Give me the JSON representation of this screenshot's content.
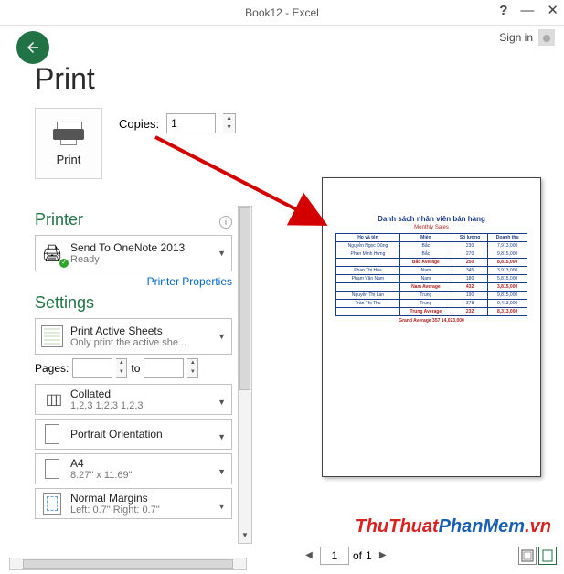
{
  "title": "Book12 - Excel",
  "signin": "Sign in",
  "back_aria": "Back",
  "page_header": "Print",
  "print_button": "Print",
  "copies": {
    "label": "Copies:",
    "value": "1"
  },
  "printer": {
    "header": "Printer",
    "name": "Send To OneNote 2013",
    "status": "Ready",
    "properties_link": "Printer Properties"
  },
  "settings": {
    "header": "Settings",
    "active_sheets": {
      "l1": "Print Active Sheets",
      "l2": "Only print the active she..."
    },
    "pages": {
      "label": "Pages:",
      "from": "",
      "to_label": "to",
      "to": ""
    },
    "collated": {
      "l1": "Collated",
      "l2": "1,2,3   1,2,3   1,2,3"
    },
    "orientation": "Portrait Orientation",
    "paper": {
      "l1": "A4",
      "l2": "8.27\" x 11.69\""
    },
    "margins": {
      "l1": "Normal Margins",
      "l2": "Left: 0.7\"   Right: 0.7\""
    }
  },
  "preview_doc": {
    "title": "Danh sách nhân viên bán hàng",
    "subtitle": "Monthly Sales",
    "headers": [
      "Họ và tên",
      "Miền",
      "Số lượng",
      "Doanh thu"
    ],
    "rows": [
      [
        "Nguyễn Ngọc Dũng",
        "Bắc",
        "230",
        "7,913,000"
      ],
      [
        "Phan Minh Hưng",
        "Bắc",
        "270",
        "9,815,000"
      ],
      [
        "",
        "Bắc Average",
        "250",
        "8,815,000"
      ],
      [
        "Phan Thị Hòa",
        "Nam",
        "345",
        "3,913,000"
      ],
      [
        "Phạm Văn Nam",
        "Nam",
        "180",
        "5,815,000"
      ],
      [
        "",
        "Nam Average",
        "432",
        "3,815,000"
      ],
      [
        "Nguyễn Thị Lan",
        "Trung",
        "190",
        "9,815,000"
      ],
      [
        "Trần Thị Thu",
        "Trung",
        "378",
        "9,413,000"
      ],
      [
        "",
        "Trung Average",
        "232",
        "8,313,000"
      ]
    ],
    "red_rows": [
      2,
      5,
      8
    ],
    "footer": "Grand Average   357   14,023,000"
  },
  "pagenav": {
    "current": "1",
    "of_label": "of",
    "total": "1"
  },
  "watermark": {
    "a": "ThuThuat",
    "b": "PhanMem",
    "c": ".vn"
  }
}
